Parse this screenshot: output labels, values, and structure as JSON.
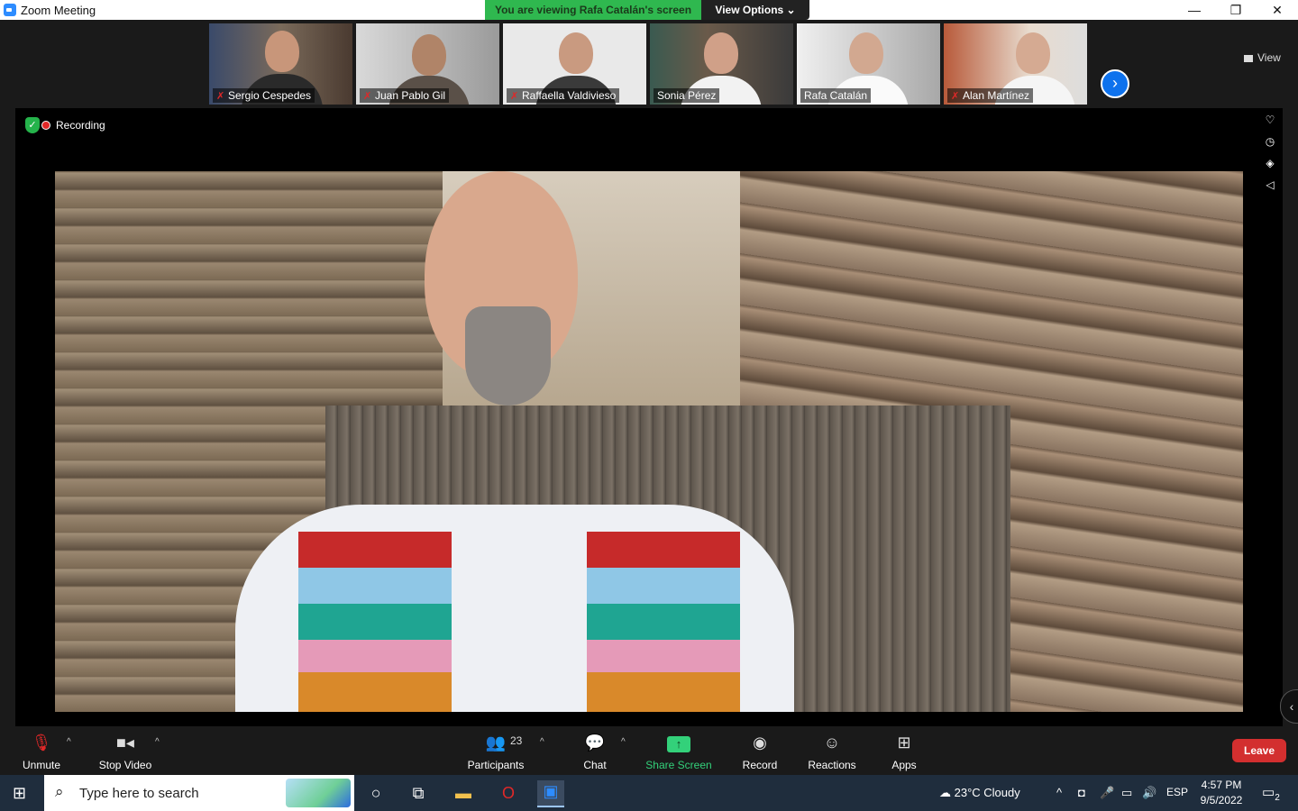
{
  "window": {
    "title": "Zoom Meeting",
    "minimize": "—",
    "restore": "❐",
    "close": "✕"
  },
  "banner": {
    "viewing": "You are viewing Rafa Catalán's screen",
    "view_options": "View Options ⌄"
  },
  "gallery": {
    "participants": [
      {
        "name": "Sergio Cespedes",
        "muted": true
      },
      {
        "name": "Juan Pablo Gil",
        "muted": true
      },
      {
        "name": "Raffaella Valdivieso",
        "muted": true
      },
      {
        "name": "Sonia Pérez",
        "muted": false
      },
      {
        "name": "Rafa Catalán",
        "muted": false
      },
      {
        "name": "Alan Martínez",
        "muted": true
      }
    ],
    "next_icon": "›",
    "view_label": "View"
  },
  "stage": {
    "recording_label": "Recording"
  },
  "toolbar": {
    "unmute": "Unmute",
    "stop_video": "Stop Video",
    "participants": "Participants",
    "participants_count": "23",
    "chat": "Chat",
    "share_screen": "Share Screen",
    "record": "Record",
    "reactions": "Reactions",
    "apps": "Apps",
    "leave": "Leave"
  },
  "taskbar": {
    "search_placeholder": "Type here to search",
    "weather": "23°C  Cloudy",
    "language": "ESP",
    "time": "4:57 PM",
    "date": "9/5/2022",
    "notifications": "2"
  },
  "colors": {
    "accent": "#0e72ed",
    "recording": "#e02828",
    "share": "#33d17a",
    "leave": "#d32f2f",
    "banner": "#2fb84f"
  }
}
